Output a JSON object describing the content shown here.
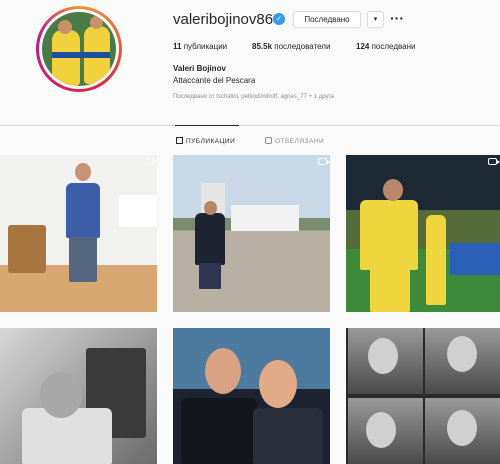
{
  "profile": {
    "username": "valeribojinov86",
    "verified_mark": "✓",
    "follow_button": "Последвано",
    "dropdown_glyph": "▾",
    "more_glyph": "···",
    "full_name": "Valeri Bojinov",
    "bio": "Attaccante del Pescara",
    "followed_by": "Последвано от tschalini, petkodimitroff, agnes_77 + 1 друга"
  },
  "stats": {
    "posts_value": "11",
    "posts_label": "публикации",
    "followers_value": "85.5k",
    "followers_label": "последователи",
    "following_value": "124",
    "following_label": "последвани"
  },
  "tabs": [
    {
      "label": "ПУБЛИКАЦИИ",
      "active": true,
      "icon": "grid-icon"
    },
    {
      "label": "ОТБЕЛЯЗАНИ",
      "active": false,
      "icon": "tagged-icon"
    }
  ],
  "posts": [
    {
      "kind": "video",
      "icon": "video-icon"
    },
    {
      "kind": "video",
      "icon": "video-icon"
    },
    {
      "kind": "video",
      "icon": "video-icon"
    },
    {
      "kind": "photo"
    },
    {
      "kind": "photo"
    },
    {
      "kind": "photo"
    }
  ],
  "colors": {
    "verified": "#3897f0",
    "ring_start": "#f09433",
    "ring_end": "#bc1888",
    "text": "#262626",
    "muted": "#8e8e8e"
  }
}
